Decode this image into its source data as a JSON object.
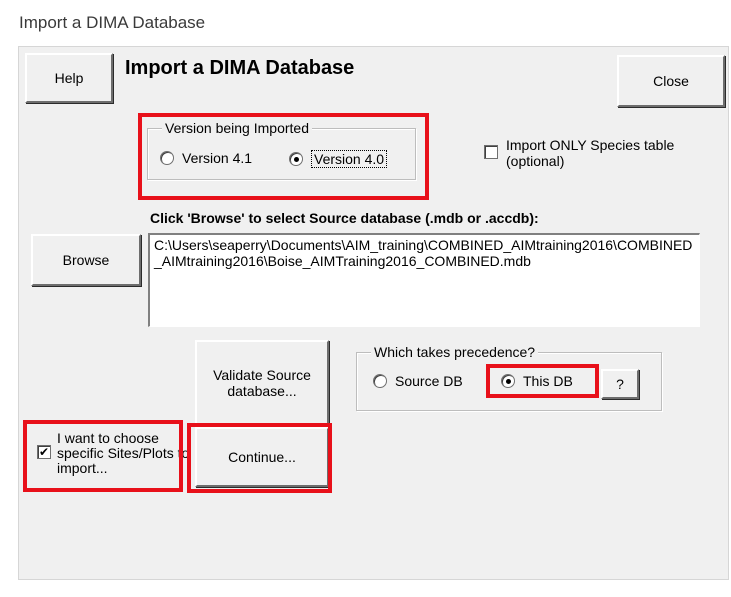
{
  "window": {
    "title": "Import a DIMA Database"
  },
  "dialog": {
    "heading": "Import a DIMA Database"
  },
  "buttons": {
    "help": "Help",
    "close": "Close",
    "browse": "Browse",
    "validate": "Validate Source database...",
    "continue": "Continue...",
    "question": "?"
  },
  "version_group": {
    "legend": "Version being Imported",
    "option1": "Version 4.1",
    "option2": "Version 4.0",
    "selected": "Version 4.0"
  },
  "species_only": {
    "label": "Import ONLY Species table (optional)",
    "checked": false
  },
  "source": {
    "prompt": "Click 'Browse' to select Source database (.mdb or .accdb):",
    "path": "C:\\Users\\seaperry\\Documents\\AIM_training\\COMBINED_AIMtraining2016\\COMBINED_AIMtraining2016\\Boise_AIMTraining2016_COMBINED.mdb"
  },
  "precedence_group": {
    "legend": "Which takes precedence?",
    "option1": "Source DB",
    "option2": "This DB",
    "selected": "This DB"
  },
  "choose_sites": {
    "label": "I want to choose specific Sites/Plots to import...",
    "checked": true
  },
  "colors": {
    "highlight": "#e8101a",
    "dialog_bg": "#f0f0f0"
  }
}
